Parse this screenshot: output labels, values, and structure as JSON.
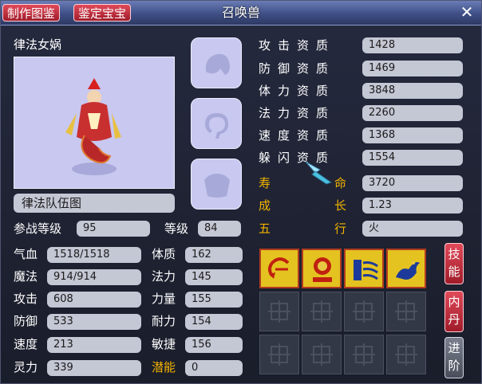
{
  "window": {
    "title": "召唤兽",
    "tabs": [
      "制作图鉴",
      "鉴定宝宝"
    ],
    "close_icon": "close-icon"
  },
  "pet": {
    "name": "律法女娲",
    "team_button": "律法队伍图"
  },
  "levels": {
    "battle_level_label": "参战等级",
    "battle_level": "95",
    "level_label": "等级",
    "level": "84"
  },
  "stats": [
    {
      "label": "气血",
      "value": "1518/1518"
    },
    {
      "label": "魔法",
      "value": "914/914"
    },
    {
      "label": "攻击",
      "value": "608"
    },
    {
      "label": "防御",
      "value": "533"
    },
    {
      "label": "速度",
      "value": "213"
    },
    {
      "label": "灵力",
      "value": "339"
    }
  ],
  "attributes": [
    {
      "label": "体质",
      "value": "162"
    },
    {
      "label": "法力",
      "value": "145"
    },
    {
      "label": "力量",
      "value": "155"
    },
    {
      "label": "耐力",
      "value": "154"
    },
    {
      "label": "敏捷",
      "value": "156"
    },
    {
      "label": "潜能",
      "value": "0"
    }
  ],
  "aptitudes": [
    {
      "label": "攻击资质",
      "value": "1428"
    },
    {
      "label": "防御资质",
      "value": "1469"
    },
    {
      "label": "体力资质",
      "value": "3848"
    },
    {
      "label": "法力资质",
      "value": "2260"
    },
    {
      "label": "速度资质",
      "value": "1368"
    },
    {
      "label": "躲闪资质",
      "value": "1554"
    }
  ],
  "extra": [
    {
      "label_a": "寿",
      "label_b": "命",
      "value": "3720"
    },
    {
      "label_a": "成",
      "label_b": "长",
      "value": "1.23"
    },
    {
      "label_a": "五",
      "label_b": "行",
      "value": "火"
    }
  ],
  "side_buttons": [
    "技能",
    "内丹",
    "进阶"
  ],
  "skill_icons": [
    "return-skill-icon",
    "seal-skill-icon",
    "flow-skill-icon",
    "dragon-skill-icon"
  ],
  "equip_slots": [
    "helmet-slot-icon",
    "collar-slot-icon",
    "armor-slot-icon"
  ]
}
